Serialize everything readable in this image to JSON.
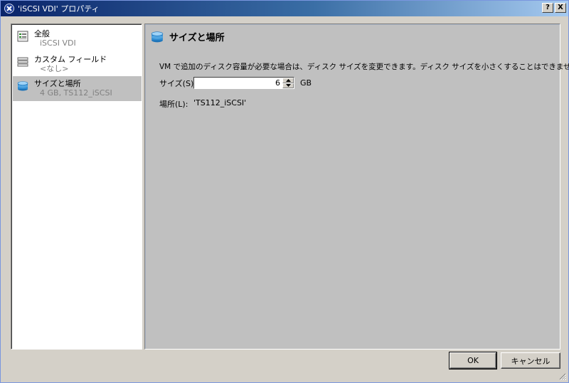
{
  "window": {
    "title": "'iSCSI VDI' プロパティ",
    "help_label": "?",
    "close_label": "X"
  },
  "sidebar": {
    "items": [
      {
        "title": "全般",
        "subtitle": "iSCSI VDI",
        "icon": "general-icon",
        "selected": false
      },
      {
        "title": "カスタム フィールド",
        "subtitle": "<なし>",
        "icon": "custom-fields-icon",
        "selected": false
      },
      {
        "title": "サイズと場所",
        "subtitle": "4 GB, TS112_iSCSI",
        "icon": "disk-icon",
        "selected": true
      }
    ]
  },
  "content": {
    "header_title": "サイズと場所",
    "description": "VM で追加のディスク容量が必要な場合は、ディスク サイズを変更できます。ディスク サイズを小さくすることはできません。",
    "size_label": "サイズ(S):",
    "size_value": "6",
    "size_unit": "GB",
    "location_label": "場所(L):",
    "location_value": "'TS112_iSCSI'"
  },
  "buttons": {
    "ok_label": "OK",
    "cancel_label": "キャンセル"
  },
  "colors": {
    "titlebar_start": "#0a246a",
    "selected_item": "#c0c0c0",
    "content_bg": "#c0c0c0"
  }
}
